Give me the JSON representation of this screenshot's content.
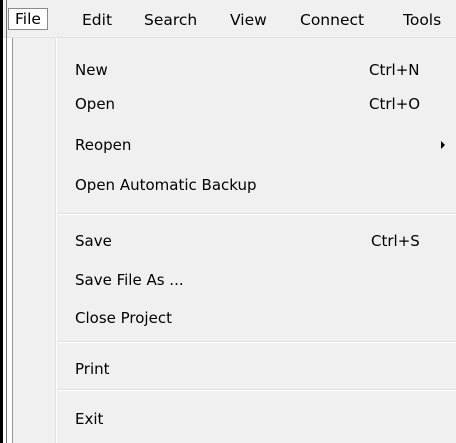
{
  "menubar": {
    "items": [
      {
        "label": "File",
        "active": true
      },
      {
        "label": "Edit"
      },
      {
        "label": "Search"
      },
      {
        "label": "View"
      },
      {
        "label": "Connect"
      },
      {
        "label": "Tools"
      }
    ]
  },
  "file_menu": {
    "items": [
      {
        "label": "New",
        "shortcut": "Ctrl+N"
      },
      {
        "label": "Open",
        "shortcut": "Ctrl+O"
      },
      {
        "label": "Reopen",
        "submenu": true
      },
      {
        "label": "Open Automatic Backup"
      },
      {
        "label": "Save",
        "shortcut": "Ctrl+S"
      },
      {
        "label": "Save File As ..."
      },
      {
        "label": "Close Project"
      },
      {
        "label": "Print"
      },
      {
        "label": "Exit"
      }
    ]
  },
  "colors": {
    "menu_background": "#f0f0f0",
    "active_item_border": "#8a8a8a",
    "text": "#000000"
  }
}
